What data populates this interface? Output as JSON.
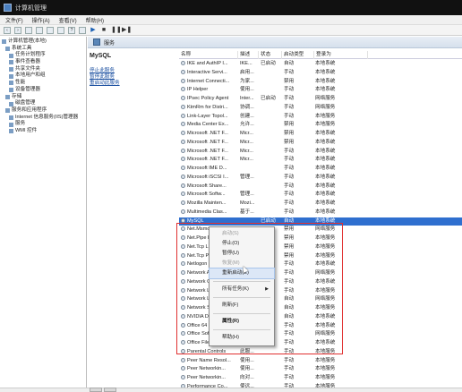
{
  "window": {
    "title": "计算机管理"
  },
  "menu": [
    "文件(F)",
    "操作(A)",
    "查看(V)",
    "帮助(H)"
  ],
  "toolbar": [
    "back",
    "forward",
    "up",
    "show-hide",
    "refresh",
    "export",
    "help",
    "properties",
    "play",
    "stop",
    "pause",
    "restart"
  ],
  "tree": [
    {
      "label": "计算机管理(本地)",
      "level": 0
    },
    {
      "label": "系统工具",
      "level": 1
    },
    {
      "label": "任务计划程序",
      "level": 2
    },
    {
      "label": "事件查看器",
      "level": 2
    },
    {
      "label": "共享文件夹",
      "level": 2
    },
    {
      "label": "本地用户和组",
      "level": 2
    },
    {
      "label": "性能",
      "level": 2
    },
    {
      "label": "设备管理器",
      "level": 2
    },
    {
      "label": "存储",
      "level": 1
    },
    {
      "label": "磁盘管理",
      "level": 2
    },
    {
      "label": "服务和应用程序",
      "level": 1
    },
    {
      "label": "Internet 信息服务(IIS)管理器",
      "level": 2
    },
    {
      "label": "服务",
      "level": 2
    },
    {
      "label": "WMI 控件",
      "level": 2
    }
  ],
  "header": {
    "title": "服务"
  },
  "description": {
    "service_name": "MySQL",
    "links": [
      "停止此服务",
      "暂停此服务",
      "重启动此服务"
    ]
  },
  "columns": [
    "名称",
    "描述",
    "状态",
    "启动类型",
    "登录为"
  ],
  "rows": [
    [
      "IKE and AuthIP I...",
      "IKE...",
      "已启动",
      "自动",
      "本地系统"
    ],
    [
      "Interactive Servi...",
      "启用...",
      "",
      "手动",
      "本地系统"
    ],
    [
      "Internet Connecti...",
      "为家...",
      "",
      "禁用",
      "本地系统"
    ],
    [
      "IP Helper",
      "使用...",
      "",
      "手动",
      "本地系统"
    ],
    [
      "IPsec Policy Agent",
      "Inter...",
      "已启动",
      "手动",
      "网络服务"
    ],
    [
      "KtmRm for Distri...",
      "协调...",
      "",
      "手动",
      "网络服务"
    ],
    [
      "Link-Layer Topol...",
      "创建...",
      "",
      "手动",
      "本地服务"
    ],
    [
      "Media Center Ex...",
      "允许...",
      "",
      "禁用",
      "本地服务"
    ],
    [
      "Microsoft .NET F...",
      "Micr...",
      "",
      "禁用",
      "本地系统"
    ],
    [
      "Microsoft .NET F...",
      "Micr...",
      "",
      "禁用",
      "本地系统"
    ],
    [
      "Microsoft .NET F...",
      "Micr...",
      "",
      "手动",
      "本地系统"
    ],
    [
      "Microsoft .NET F...",
      "Micr...",
      "",
      "手动",
      "本地系统"
    ],
    [
      "Microsoft IME D...",
      "",
      "",
      "手动",
      "本地系统"
    ],
    [
      "Microsoft iSCSI I...",
      "管理...",
      "",
      "手动",
      "本地系统"
    ],
    [
      "Microsoft Share...",
      "",
      "",
      "手动",
      "本地系统"
    ],
    [
      "Microsoft Softw...",
      "管理...",
      "",
      "手动",
      "本地系统"
    ],
    [
      "Mozilla Mainten...",
      "Mozi...",
      "",
      "手动",
      "本地系统"
    ],
    [
      "Multimedia Clas...",
      "基于...",
      "",
      "手动",
      "本地系统"
    ],
    [
      "MySQL",
      "",
      "已启动",
      "自动",
      "本地系统"
    ],
    [
      "Net.Msmq Liste...",
      "",
      "",
      "禁用",
      "网络服务"
    ],
    [
      "Net.Pipe Listen...",
      "",
      "",
      "禁用",
      "本地服务"
    ],
    [
      "Net.Tcp Listener...",
      "",
      "",
      "禁用",
      "本地服务"
    ],
    [
      "Net.Tcp Port Sh...",
      "",
      "",
      "禁用",
      "本地服务"
    ],
    [
      "Netlogon",
      "",
      "",
      "手动",
      "本地系统"
    ],
    [
      "Network Access...",
      "",
      "",
      "手动",
      "网络服务"
    ],
    [
      "Network Conne...",
      "",
      "",
      "手动",
      "本地系统"
    ],
    [
      "Network List Se...",
      "",
      "",
      "手动",
      "本地服务"
    ],
    [
      "Network Locatio...",
      "",
      "",
      "自动",
      "网络服务"
    ],
    [
      "Network Store I...",
      "",
      "",
      "自动",
      "本地服务"
    ],
    [
      "NVIDIA Display...",
      "",
      "",
      "自动",
      "本地系统"
    ],
    [
      "Office 64 Source...",
      "保存...",
      "",
      "手动",
      "本地系统"
    ],
    [
      "Office Software ...",
      "Offi...",
      "",
      "手动",
      "网络服务"
    ],
    [
      "Office Files",
      "",
      "",
      "手动",
      "本地系统"
    ],
    [
      "Parental Controls",
      "此服...",
      "",
      "手动",
      "本地服务"
    ],
    [
      "Peer Name Resol...",
      "使用...",
      "",
      "手动",
      "本地服务"
    ],
    [
      "Peer Networkin...",
      "使用...",
      "",
      "手动",
      "本地服务"
    ],
    [
      "Peer Networkin...",
      "向对...",
      "",
      "手动",
      "本地服务"
    ],
    [
      "Performance Co...",
      "使远...",
      "",
      "手动",
      "本地服务"
    ]
  ],
  "selected_row": 18,
  "context_menu": {
    "items": [
      {
        "label": "启动(S)",
        "disabled": true
      },
      {
        "label": "停止(O)",
        "disabled": false
      },
      {
        "label": "暂停(U)",
        "disabled": false
      },
      {
        "label": "恢复(M)",
        "disabled": true
      },
      {
        "label": "重新启动(E)",
        "disabled": false,
        "hovered": true
      },
      {
        "sep": true
      },
      {
        "label": "所有任务(K)",
        "disabled": false,
        "submenu": true
      },
      {
        "sep": true
      },
      {
        "label": "刷新(F)",
        "disabled": false
      },
      {
        "sep": true
      },
      {
        "label": "属性(R)",
        "disabled": false,
        "bold": true
      },
      {
        "sep": true
      },
      {
        "label": "帮助(H)",
        "disabled": false
      }
    ]
  },
  "colors": {
    "selection": "#2f6fcf",
    "highlight_box": "#e03030"
  }
}
